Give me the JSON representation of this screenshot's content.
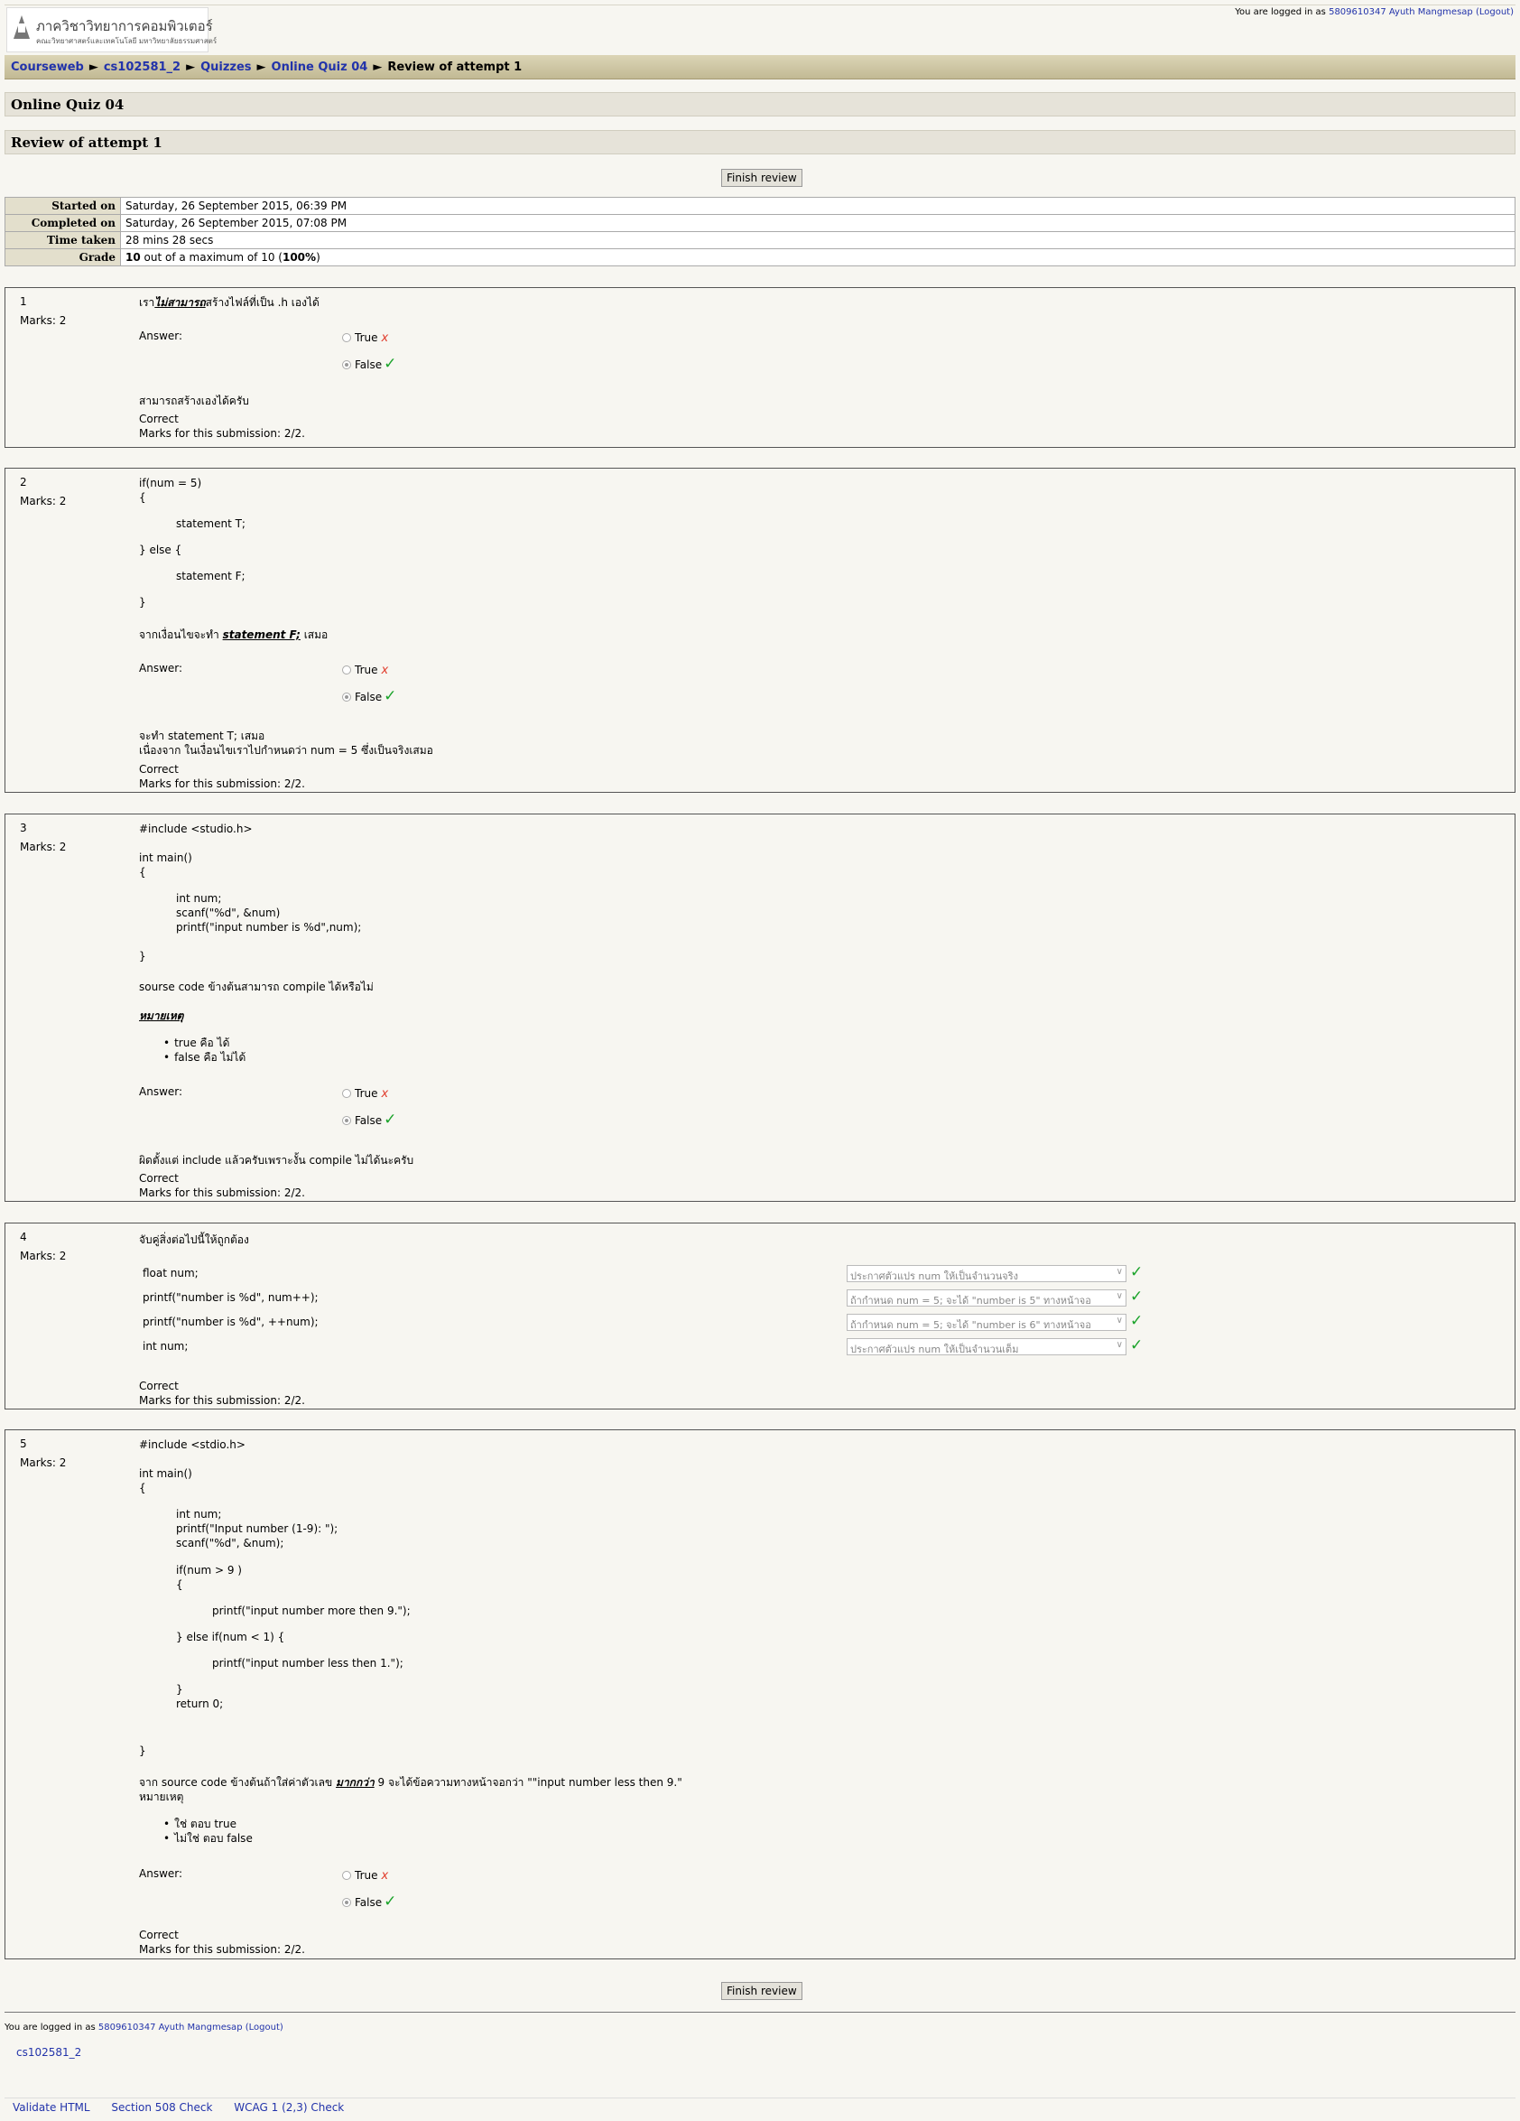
{
  "header": {
    "logo_line1": "ภาควิชาวิทยาการคอมพิวเตอร์",
    "logo_line2": "คณะวิทยาศาสตร์และเทคโนโลยี มหาวิทยาลัยธรรมศาสตร์",
    "login_prefix": "You are logged in as",
    "user_name": "5809610347 Ayuth Mangmesap",
    "logout_label": "(Logout)"
  },
  "breadcrumb": {
    "items": [
      "Courseweb",
      "cs102581_2",
      "Quizzes",
      "Online Quiz 04"
    ],
    "current": "Review of attempt 1",
    "separator": "►"
  },
  "page": {
    "quiz_title": "Online Quiz 04",
    "review_title": "Review of attempt 1",
    "finish_label": "Finish review"
  },
  "summary": {
    "started_label": "Started on",
    "started_value": "Saturday, 26 September 2015, 06:39 PM",
    "completed_label": "Completed on",
    "completed_value": "Saturday, 26 September 2015, 07:08 PM",
    "time_label": "Time taken",
    "time_value": "28 mins 28 secs",
    "grade_label": "Grade",
    "grade_score": "10",
    "grade_mid": "out of a maximum of 10 (",
    "grade_pct": "100%",
    "grade_end": ")"
  },
  "common": {
    "marks_label": "Marks: 2",
    "answer_label": "Answer:",
    "true_label": "True",
    "false_label": "False",
    "x_mark": "x",
    "tick": "✓",
    "correct": "Correct",
    "marks_submission": "Marks for this submission: 2/2."
  },
  "q1": {
    "num": "1",
    "text_pre": "เรา",
    "text_em": "ไม่สามารถ",
    "text_post": "สร้างไฟล์ที่เป็น .h เองได้",
    "feedback": "สามารถสร้างเองได้ครับ"
  },
  "q2": {
    "num": "2",
    "code": [
      "if(num = 5)",
      "{",
      "statement T;",
      "} else {",
      "statement F;",
      "}"
    ],
    "text_pre": "จากเงื่อนไขจะทำ ",
    "text_em": "statement F;",
    "text_post": " เสมอ",
    "feedback1": "จะทำ statement T; เสมอ",
    "feedback2": "เนื่องจาก ในเงื่อนไขเราไปกำหนดว่า num = 5 ซึ่งเป็นจริงเสมอ"
  },
  "q3": {
    "num": "3",
    "code": [
      "#include <studio.h>",
      "int main()",
      "{",
      "int num;",
      "scanf(\"%d\", &num)",
      "printf(\"input number is %d\",num);",
      "}"
    ],
    "text": "sourse code ข้างต้นสามารถ compile ได้หรือไม่",
    "note": "หมายเหตุ",
    "bullets": [
      "true คือ ได้",
      "false คือ ไม่ได้"
    ],
    "feedback": "ผิดตั้งแต่ include แล้วครับเพราะงั้น compile ไม่ได้นะครับ"
  },
  "q4": {
    "num": "4",
    "text": "จับคู่สิ่งต่อไปนี้ให้ถูกต้อง",
    "rows": [
      {
        "stem": "float num;",
        "answer": "ประกาศตัวแปร num ให้เป็นจำนวนจริง"
      },
      {
        "stem": "printf(\"number is %d\", num++);",
        "answer": "ถ้ากำหนด num = 5; จะได้ \"number is 5\" ทางหน้าจอ"
      },
      {
        "stem": "printf(\"number is %d\", ++num);",
        "answer": "ถ้ากำหนด num = 5; จะได้ \"number is 6\" ทางหน้าจอ"
      },
      {
        "stem": "int num;",
        "answer": "ประกาศตัวแปร num ให้เป็นจำนวนเต็ม"
      }
    ]
  },
  "q5": {
    "num": "5",
    "code": [
      "#include <stdio.h>",
      "int main()",
      "{",
      "int num;",
      "printf(\"Input number (1-9): \");",
      "scanf(\"%d\", &num);",
      "if(num > 9 )",
      "{",
      "printf(\"input number more then 9.\");",
      "} else if(num < 1) {",
      "printf(\"input number less then 1.\");",
      "}",
      "return 0;",
      "}"
    ],
    "text_pre": "จาก source code ข้างต้นถ้าใส่ค่าตัวเลข ",
    "text_em": "มากกว่า",
    "text_post": " 9 จะได้ข้อความทางหน้าจอกว่า \"\"input number less then 9.\"",
    "note": "หมายเหตุ",
    "bullets": [
      "ใช่ ตอบ true",
      "ไม่ใช่ ตอบ false"
    ]
  },
  "footer": {
    "course_link": "cs102581_2",
    "validators": [
      "Validate HTML",
      "Section 508 Check",
      "WCAG 1 (2,3) Check"
    ]
  }
}
